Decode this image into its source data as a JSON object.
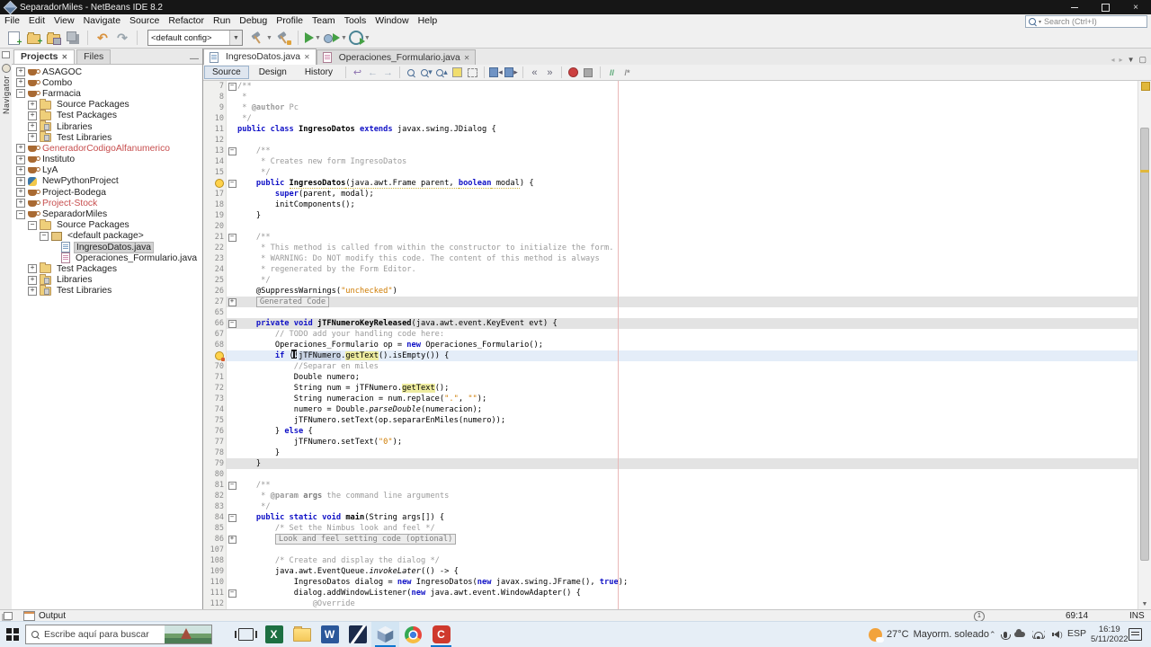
{
  "window": {
    "title": "SeparadorMiles - NetBeans IDE 8.2",
    "controls": {
      "minimize": "minimize",
      "maximize": "maximize",
      "close": "close"
    }
  },
  "menubar": {
    "items": [
      "File",
      "Edit",
      "View",
      "Navigate",
      "Source",
      "Refactor",
      "Run",
      "Debug",
      "Profile",
      "Team",
      "Tools",
      "Window",
      "Help"
    ],
    "search_placeholder": "Search (Ctrl+I)"
  },
  "toolbar": {
    "config_value": "<default config>",
    "buttons": [
      {
        "name": "new-file-button",
        "type": "newfile"
      },
      {
        "name": "new-project-button",
        "type": "newproject"
      },
      {
        "name": "open-project-button",
        "type": "openproj"
      },
      {
        "name": "save-all-button",
        "type": "saveall"
      },
      {
        "name": "sep",
        "type": "sep"
      },
      {
        "name": "undo-button",
        "type": "undo"
      },
      {
        "name": "redo-button",
        "type": "redo"
      },
      {
        "name": "sep",
        "type": "sep"
      },
      {
        "name": "config-combo",
        "type": "combo"
      },
      {
        "name": "build-project-button",
        "type": "build"
      },
      {
        "name": "clean-build-button",
        "type": "cleanbuild"
      },
      {
        "name": "sep",
        "type": "sep"
      },
      {
        "name": "run-project-button",
        "type": "run"
      },
      {
        "name": "debug-project-button",
        "type": "debug"
      },
      {
        "name": "profile-project-button",
        "type": "profile"
      }
    ]
  },
  "panels": {
    "navigator_label": "Navigator",
    "projects": {
      "tabs": [
        {
          "label": "Projects",
          "active": true
        },
        {
          "label": "Files",
          "active": false
        }
      ],
      "tree": [
        {
          "label": "ASAGOC",
          "depth": 0,
          "expand": "+",
          "icon": "project"
        },
        {
          "label": "Combo",
          "depth": 0,
          "expand": "+",
          "icon": "project"
        },
        {
          "label": "Farmacia",
          "depth": 0,
          "expand": "-",
          "icon": "project"
        },
        {
          "label": "Source Packages",
          "depth": 1,
          "expand": "+",
          "icon": "pkgfolder"
        },
        {
          "label": "Test Packages",
          "depth": 1,
          "expand": "+",
          "icon": "pkgfolder"
        },
        {
          "label": "Libraries",
          "depth": 1,
          "expand": "+",
          "icon": "libfolder"
        },
        {
          "label": "Test Libraries",
          "depth": 1,
          "expand": "+",
          "icon": "libfolder"
        },
        {
          "label": "GeneradorCodigoAlfanumerico",
          "depth": 0,
          "expand": "+",
          "icon": "project",
          "error": true
        },
        {
          "label": "Instituto",
          "depth": 0,
          "expand": "+",
          "icon": "project"
        },
        {
          "label": "LyA",
          "depth": 0,
          "expand": "+",
          "icon": "project"
        },
        {
          "label": "NewPythonProject",
          "depth": 0,
          "expand": "+",
          "icon": "python"
        },
        {
          "label": "Project-Bodega",
          "depth": 0,
          "expand": "+",
          "icon": "project"
        },
        {
          "label": "Project-Stock",
          "depth": 0,
          "expand": "+",
          "icon": "project",
          "error": true
        },
        {
          "label": "SeparadorMiles",
          "depth": 0,
          "expand": "-",
          "icon": "project"
        },
        {
          "label": "Source Packages",
          "depth": 1,
          "expand": "-",
          "icon": "pkgfolder"
        },
        {
          "label": "<default package>",
          "depth": 2,
          "expand": "-",
          "icon": "package"
        },
        {
          "label": "IngresoDatos.java",
          "depth": 3,
          "expand": "none",
          "icon": "javafile",
          "selected": true
        },
        {
          "label": "Operaciones_Formulario.java",
          "depth": 3,
          "expand": "none",
          "icon": "formfile"
        },
        {
          "label": "Test Packages",
          "depth": 1,
          "expand": "+",
          "icon": "pkgfolder"
        },
        {
          "label": "Libraries",
          "depth": 1,
          "expand": "+",
          "icon": "libfolder"
        },
        {
          "label": "Test Libraries",
          "depth": 1,
          "expand": "+",
          "icon": "libfolder"
        }
      ]
    },
    "output_label": "Output"
  },
  "editor": {
    "tabs": [
      {
        "label": "IngresoDatos.java",
        "icon": "javafile",
        "active": true
      },
      {
        "label": "Operaciones_Formulario.java",
        "icon": "formfile",
        "active": false
      }
    ],
    "views": [
      {
        "label": "Source",
        "active": true
      },
      {
        "label": "Design",
        "active": false
      },
      {
        "label": "History",
        "active": false
      }
    ],
    "toolbar_icons": [
      {
        "name": "last-edit-icon",
        "type": "editpos"
      },
      {
        "name": "back-icon",
        "type": "back"
      },
      {
        "name": "forward-icon",
        "type": "fwd"
      },
      {
        "name": "sep",
        "type": "sep"
      },
      {
        "name": "find-selection-icon",
        "type": "mag"
      },
      {
        "name": "find-next-icon",
        "type": "magv"
      },
      {
        "name": "find-previous-icon",
        "type": "magp"
      },
      {
        "name": "toggle-highlight-icon",
        "type": "hl"
      },
      {
        "name": "rectangular-selection-icon",
        "type": "rect"
      },
      {
        "name": "sep",
        "type": "sep"
      },
      {
        "name": "previous-bookmark-icon",
        "type": "bmp"
      },
      {
        "name": "next-bookmark-icon",
        "type": "bmn"
      },
      {
        "name": "sep",
        "type": "sep"
      },
      {
        "name": "shift-left-icon",
        "type": "shl"
      },
      {
        "name": "shift-right-icon",
        "type": "shr"
      },
      {
        "name": "sep",
        "type": "sep"
      },
      {
        "name": "record-macro-icon",
        "type": "rec"
      },
      {
        "name": "finish-macro-icon",
        "type": "stop"
      },
      {
        "name": "sep",
        "type": "sep"
      },
      {
        "name": "comment-icon",
        "type": "cmnt"
      },
      {
        "name": "uncomment-icon",
        "type": "uncmnt"
      }
    ],
    "code_lines": [
      {
        "num": "7",
        "fold": "open",
        "segs": [
          [
            "/**",
            "cmt"
          ]
        ]
      },
      {
        "num": "8",
        "segs": [
          [
            " *",
            "cmt"
          ]
        ]
      },
      {
        "num": "9",
        "segs": [
          [
            " * ",
            "cmt"
          ],
          [
            "@author",
            "cmtb"
          ],
          [
            " Pc",
            "cmt"
          ]
        ]
      },
      {
        "num": "10",
        "segs": [
          [
            " */",
            "cmt"
          ]
        ]
      },
      {
        "num": "11",
        "segs": [
          [
            "public class ",
            "kw"
          ],
          [
            "IngresoDatos",
            "decl"
          ],
          [
            " ",
            "p"
          ],
          [
            "extends",
            "kw"
          ],
          [
            " javax.swing.JDialog {",
            "p"
          ]
        ]
      },
      {
        "num": "12",
        "segs": []
      },
      {
        "num": "13",
        "fold": "open",
        "segs": [
          [
            "    /**",
            "cmt"
          ]
        ]
      },
      {
        "num": "14",
        "segs": [
          [
            "     * Creates new form IngresoDatos",
            "cmt"
          ]
        ]
      },
      {
        "num": "15",
        "segs": [
          [
            "     */",
            "cmt"
          ]
        ]
      },
      {
        "num": "16",
        "fold": "open",
        "gutter": "bulb",
        "segs": [
          [
            "    ",
            "p"
          ],
          [
            "public ",
            "kw"
          ],
          [
            "IngresoDatos",
            "decl warn"
          ],
          [
            "(java.awt.Frame parent, ",
            "p warn"
          ],
          [
            "boolean",
            "kw warn"
          ],
          [
            " modal",
            "p warn"
          ],
          [
            ") {",
            "p"
          ]
        ]
      },
      {
        "num": "17",
        "segs": [
          [
            "        ",
            "p"
          ],
          [
            "super",
            "kw"
          ],
          [
            "(parent, modal);",
            "p"
          ]
        ]
      },
      {
        "num": "18",
        "segs": [
          [
            "        initComponents();",
            "p"
          ]
        ]
      },
      {
        "num": "19",
        "segs": [
          [
            "    }",
            "p"
          ]
        ]
      },
      {
        "num": "20",
        "segs": []
      },
      {
        "num": "21",
        "fold": "open",
        "segs": [
          [
            "    /**",
            "cmt"
          ]
        ]
      },
      {
        "num": "22",
        "segs": [
          [
            "     * This method is called from within the constructor to initialize the form.",
            "cmt"
          ]
        ]
      },
      {
        "num": "23",
        "segs": [
          [
            "     * WARNING: Do NOT modify this code. The content of this method is always",
            "cmt"
          ]
        ]
      },
      {
        "num": "24",
        "segs": [
          [
            "     * regenerated by the Form Editor.",
            "cmt"
          ]
        ]
      },
      {
        "num": "25",
        "segs": [
          [
            "     */",
            "cmt"
          ]
        ]
      },
      {
        "num": "26",
        "segs": [
          [
            "    @SuppressWarnings(",
            "p"
          ],
          [
            "\"unchecked\"",
            "str"
          ],
          [
            ")",
            "p"
          ]
        ]
      },
      {
        "num": "27",
        "fold": "closed",
        "band": true,
        "segs": [
          [
            "    ",
            "p"
          ],
          [
            "Generated Code",
            "foldbox"
          ]
        ]
      },
      {
        "num": "65",
        "segs": []
      },
      {
        "num": "66",
        "fold": "open",
        "band": true,
        "segs": [
          [
            "    ",
            "p"
          ],
          [
            "private void ",
            "kw"
          ],
          [
            "jTFNumeroKeyReleased",
            "decl"
          ],
          [
            "(java.awt.event.KeyEvent evt) {",
            "p"
          ]
        ]
      },
      {
        "num": "67",
        "segs": [
          [
            "        ",
            "p"
          ],
          [
            "// TODO add your handling code here:",
            "cmt"
          ]
        ]
      },
      {
        "num": "68",
        "segs": [
          [
            "        Operaciones_Formulario op = ",
            "p"
          ],
          [
            "new",
            "kw"
          ],
          [
            " Operaciones_Formulario();",
            "p"
          ]
        ]
      },
      {
        "num": "69",
        "gutter": "warnbulb",
        "current": true,
        "segs": [
          [
            "        ",
            "p"
          ],
          [
            "if",
            "kw"
          ],
          [
            " (!",
            "p"
          ],
          [
            "jTFNumero",
            "hlB"
          ],
          [
            ".",
            "p"
          ],
          [
            "getText",
            "hlY"
          ],
          [
            "().isEmpty()) {",
            "p"
          ]
        ]
      },
      {
        "num": "70",
        "segs": [
          [
            "            ",
            "p"
          ],
          [
            "//Separar en miles",
            "cmt"
          ]
        ]
      },
      {
        "num": "71",
        "segs": [
          [
            "            Double numero;",
            "p"
          ]
        ]
      },
      {
        "num": "72",
        "segs": [
          [
            "            String num = jTFNumero.",
            "p"
          ],
          [
            "getText",
            "hlY"
          ],
          [
            "();",
            "p"
          ]
        ]
      },
      {
        "num": "73",
        "segs": [
          [
            "            String numeracion = num.replace(",
            "p"
          ],
          [
            "\".\"",
            "str"
          ],
          [
            ", ",
            "p"
          ],
          [
            "\"\"",
            "str"
          ],
          [
            ");",
            "p"
          ]
        ]
      },
      {
        "num": "74",
        "segs": [
          [
            "            numero = Double.",
            "p"
          ],
          [
            "parseDouble",
            "ital"
          ],
          [
            "(numeracion);",
            "p"
          ]
        ]
      },
      {
        "num": "75",
        "segs": [
          [
            "            jTFNumero.setText(op.separarEnMiles(numero));",
            "p"
          ]
        ]
      },
      {
        "num": "76",
        "segs": [
          [
            "        } ",
            "p"
          ],
          [
            "else",
            "kw"
          ],
          [
            " {",
            "p"
          ]
        ]
      },
      {
        "num": "77",
        "segs": [
          [
            "            jTFNumero.setText(",
            "p"
          ],
          [
            "\"0\"",
            "str"
          ],
          [
            ");",
            "p"
          ]
        ]
      },
      {
        "num": "78",
        "segs": [
          [
            "        }",
            "p"
          ]
        ]
      },
      {
        "num": "79",
        "band": true,
        "segs": [
          [
            "    }",
            "p"
          ]
        ]
      },
      {
        "num": "80",
        "segs": []
      },
      {
        "num": "81",
        "fold": "open",
        "segs": [
          [
            "    /**",
            "cmt"
          ]
        ]
      },
      {
        "num": "82",
        "segs": [
          [
            "     * ",
            "cmt"
          ],
          [
            "@param",
            "cmtb"
          ],
          [
            " ",
            "cmt"
          ],
          [
            "args",
            "cmtb2"
          ],
          [
            " the command line arguments",
            "cmt"
          ]
        ]
      },
      {
        "num": "83",
        "segs": [
          [
            "     */",
            "cmt"
          ]
        ]
      },
      {
        "num": "84",
        "fold": "open",
        "segs": [
          [
            "    ",
            "p"
          ],
          [
            "public static void ",
            "kw"
          ],
          [
            "main",
            "decl"
          ],
          [
            "(String args[]) {",
            "p"
          ]
        ]
      },
      {
        "num": "85",
        "segs": [
          [
            "        ",
            "p"
          ],
          [
            "/* Set the Nimbus look and feel */",
            "cmt"
          ]
        ]
      },
      {
        "num": "86",
        "fold": "closed",
        "segs": [
          [
            "        ",
            "p"
          ],
          [
            "Look and feel setting code (optional)",
            "foldbox"
          ]
        ]
      },
      {
        "num": "107",
        "segs": []
      },
      {
        "num": "108",
        "segs": [
          [
            "        ",
            "p"
          ],
          [
            "/* Create and display the dialog */",
            "cmt"
          ]
        ]
      },
      {
        "num": "109",
        "segs": [
          [
            "        java.awt.EventQueue.",
            "p"
          ],
          [
            "invokeLater",
            "ital"
          ],
          [
            "(() -> {",
            "p"
          ]
        ]
      },
      {
        "num": "110",
        "segs": [
          [
            "            IngresoDatos dialog = ",
            "p"
          ],
          [
            "new",
            "kw"
          ],
          [
            " IngresoDatos(",
            "p"
          ],
          [
            "new",
            "kw"
          ],
          [
            " javax.swing.JFrame(), ",
            "p"
          ],
          [
            "true",
            "kw"
          ],
          [
            ");",
            "p"
          ]
        ]
      },
      {
        "num": "111",
        "fold": "open",
        "segs": [
          [
            "            dialog.addWindowListener(",
            "p"
          ],
          [
            "new",
            "kw"
          ],
          [
            " java.awt.event.WindowAdapter() {",
            "p"
          ]
        ]
      },
      {
        "num": "112",
        "segs": [
          [
            "                ",
            "p"
          ],
          [
            "@Override",
            "ann"
          ]
        ]
      }
    ]
  },
  "statusbar": {
    "notification_count": "1",
    "caret_position": "69:14",
    "insert_mode": "INS"
  },
  "taskbar": {
    "search_placeholder": "Escribe aquí para buscar",
    "apps": [
      {
        "name": "task-view-button",
        "type": "taskview"
      },
      {
        "name": "excel-button",
        "type": "excel",
        "letter": "X"
      },
      {
        "name": "file-explorer-button",
        "type": "explorer"
      },
      {
        "name": "word-button",
        "type": "word",
        "letter": "W"
      },
      {
        "name": "designer-app-button",
        "type": "designer"
      },
      {
        "name": "netbeans-button",
        "type": "netbeans",
        "active": true,
        "running": true
      },
      {
        "name": "chrome-button",
        "type": "chrome"
      },
      {
        "name": "camtasia-button",
        "type": "camtasia",
        "letter": "C",
        "running": true
      }
    ],
    "weather": {
      "temperature": "27°C",
      "condition": "Mayorm. soleado"
    },
    "tray": {
      "language": "ESP",
      "time": "16:19",
      "date": "5/11/2022"
    }
  },
  "colors": {
    "accent_blue": "#0f77d0",
    "keyword_blue": "#1011c6",
    "string_orange": "#ce7b00",
    "comment_gray": "#9b9b9b",
    "error_red": "#c74e4e",
    "run_green": "#45a045",
    "occurrence_yellow": "#eeeca0",
    "current_line": "#e4edf8",
    "margin_line": "#e9b8b8"
  }
}
